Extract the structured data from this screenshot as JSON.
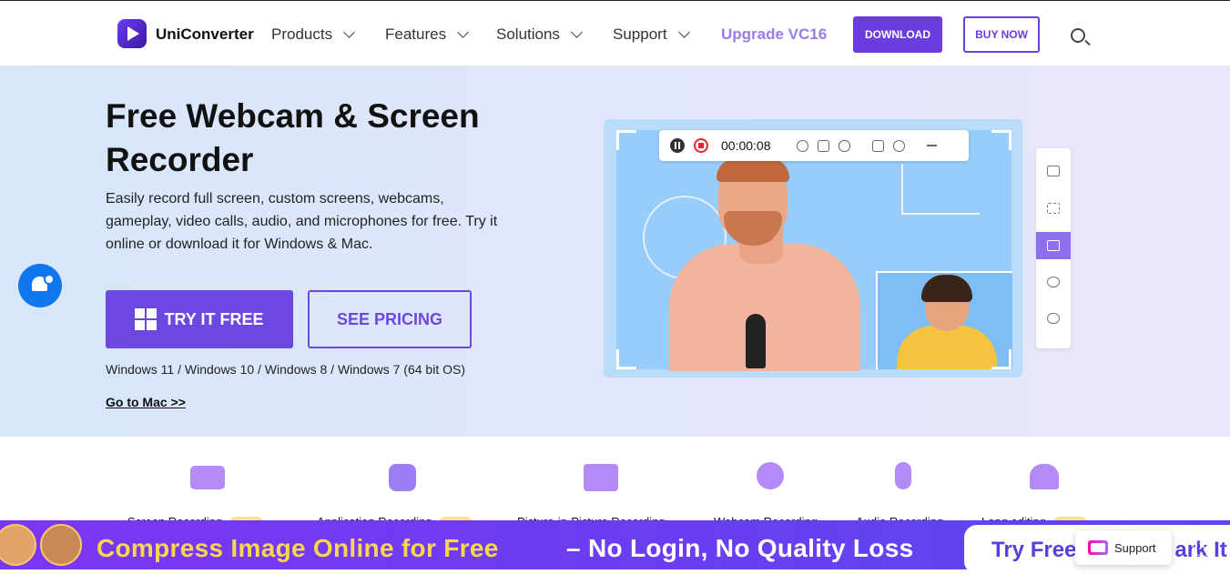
{
  "nav": {
    "brand": "UniConverter",
    "menu": [
      "Products",
      "Features",
      "Solutions",
      "Support"
    ],
    "upgrade": "Upgrade VC16",
    "download": "DOWNLOAD",
    "buy_now": "BUY NOW"
  },
  "hero": {
    "title_line1": "Free Webcam & Screen",
    "title_line2": "Recorder",
    "description": "Easily record full screen, custom screens, webcams, gameplay, video calls, audio, and microphones for free. Try it online or download it for Windows & Mac.",
    "try_free": "TRY IT FREE",
    "see_pricing": "SEE PRICING",
    "os_support": "Windows 11 / Windows 10 / Windows 8 / Windows 7 (64 bit OS)",
    "mac_link": "Go to Mac >>"
  },
  "recorder": {
    "timer": "00:00:08"
  },
  "features": [
    {
      "label": "Screen Recording",
      "badge": "NEW",
      "icon": "video-camera-icon",
      "color": "#a46bf5"
    },
    {
      "label": "Application Recording",
      "badge": "NEW",
      "icon": "app-store-icon",
      "color": "#8b6cf6"
    },
    {
      "label": "Picture-in-Picture Recording",
      "badge": "",
      "icon": "pip-icon",
      "color": "#9a6af3"
    },
    {
      "label": "Webcam Recording",
      "badge": "",
      "icon": "webcam-icon",
      "color": "#a46bf5"
    },
    {
      "label": "Audio Recording",
      "badge": "",
      "icon": "microphone-icon",
      "color": "#a46bf5"
    },
    {
      "label": "Long editing",
      "badge": "NEW",
      "icon": "stamp-icon",
      "color": "#a46bf5"
    }
  ],
  "banner": {
    "left_text": "Compress Image Online for Free",
    "right_text": "– No Login, No Quality Loss",
    "cta": "Try Free",
    "cta_tail": "ark It"
  },
  "support": {
    "label": "Support"
  },
  "colors": {
    "primary": "#6b3ddf",
    "banner": "#6a3ef0",
    "banner_highlight": "#f8d74b"
  }
}
